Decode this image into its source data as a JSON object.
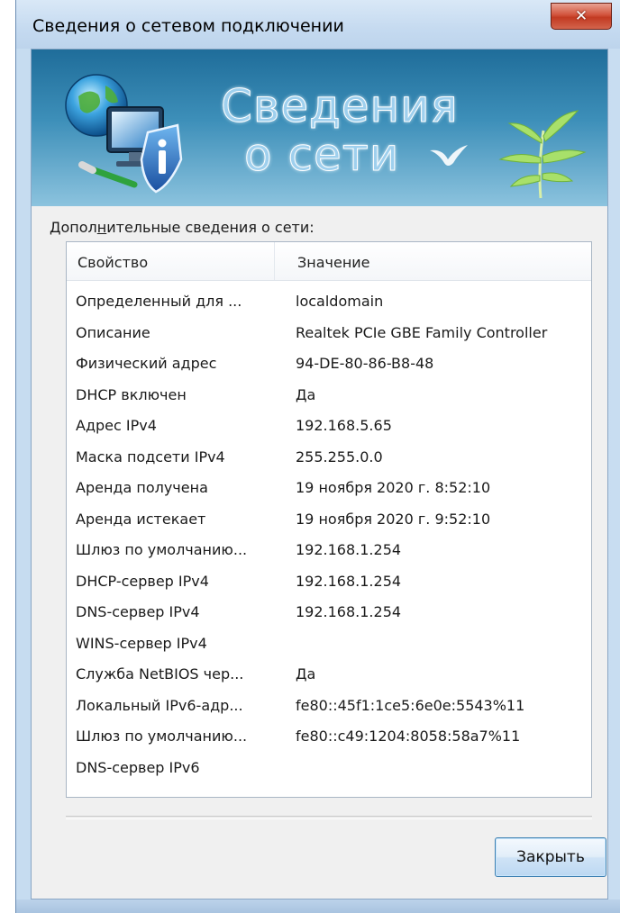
{
  "window": {
    "title": "Сведения о сетевом подключении",
    "close_glyph": "✕"
  },
  "banner": {
    "title_line1": "Сведения",
    "title_line2": "о сети",
    "icons": [
      "network-globe-monitor-icon",
      "info-shield-icon",
      "bamboo-plant-icon",
      "bird-icon"
    ]
  },
  "details": {
    "label_before": "Допол",
    "label_accel": "н",
    "label_after": "ительные сведения о сети:",
    "columns": {
      "property": "Свойство",
      "value": "Значение"
    },
    "rows": [
      {
        "property": "Определенный для ...",
        "value": "localdomain"
      },
      {
        "property": "Описание",
        "value": "Realtek PCIe GBE Family Controller"
      },
      {
        "property": "Физический адрес",
        "value": "94-DE-80-86-B8-48"
      },
      {
        "property": "DHCP включен",
        "value": "Да"
      },
      {
        "property": "Адрес IPv4",
        "value": "192.168.5.65"
      },
      {
        "property": "Маска подсети IPv4",
        "value": "255.255.0.0"
      },
      {
        "property": "Аренда получена",
        "value": "19 ноября 2020 г. 8:52:10"
      },
      {
        "property": "Аренда истекает",
        "value": "19 ноября 2020 г. 9:52:10"
      },
      {
        "property": "Шлюз по умолчанию...",
        "value": "192.168.1.254"
      },
      {
        "property": "DHCP-сервер IPv4",
        "value": "192.168.1.254"
      },
      {
        "property": "DNS-сервер IPv4",
        "value": "192.168.1.254"
      },
      {
        "property": "WINS-сервер IPv4",
        "value": ""
      },
      {
        "property": "Служба NetBIOS чер...",
        "value": "Да"
      },
      {
        "property": "Локальный IPv6-адр...",
        "value": "fe80::45f1:1ce5:6e0e:5543%11"
      },
      {
        "property": "Шлюз по умолчанию...",
        "value": "fe80::c49:1204:8058:58a7%11"
      },
      {
        "property": "DNS-сервер IPv6",
        "value": ""
      }
    ]
  },
  "buttons": {
    "close_label": "Закрыть"
  },
  "colors": {
    "title_bar": "#c5daf0",
    "close_button_red": "#c23a22",
    "banner_blue": "#3d8fb9",
    "button_border": "#3c7fb1"
  }
}
